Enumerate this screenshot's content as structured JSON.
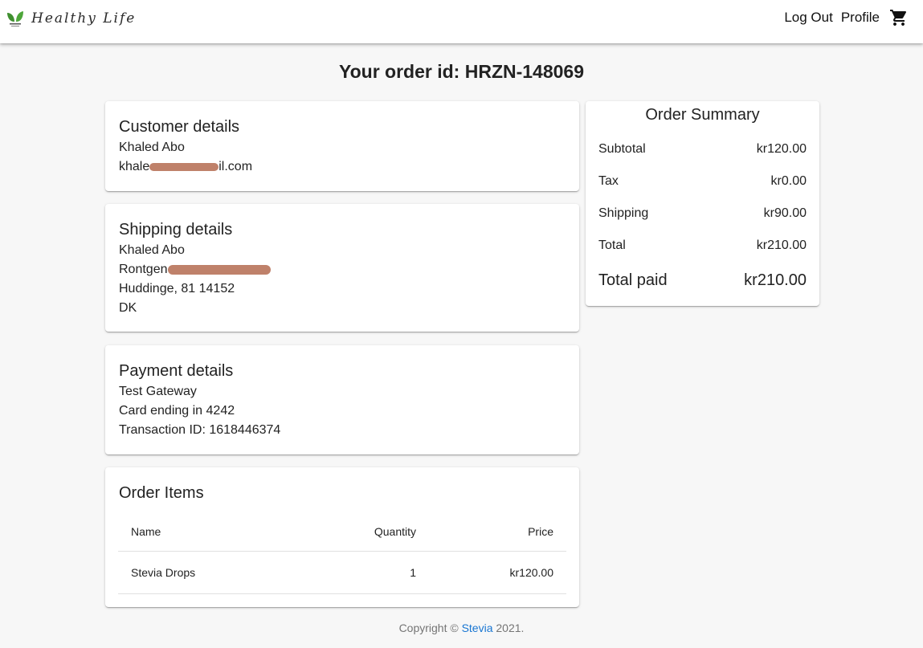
{
  "brand": {
    "title": "Healthy Life",
    "logo_icon": "leaf-logo-icon",
    "logo_color": "#3f8f2f"
  },
  "nav": {
    "logout": "Log Out",
    "profile": "Profile",
    "cart_icon": "shopping-cart-icon"
  },
  "page": {
    "title": "Your order id: HRZN-148069"
  },
  "customer": {
    "heading": "Customer details",
    "name": "Khaled Abo",
    "email_prefix": "khale",
    "email_suffix": "il.com",
    "email_redacted": true
  },
  "shipping": {
    "heading": "Shipping details",
    "name": "Khaled Abo",
    "street_prefix": "Rontgen",
    "street_redacted": true,
    "city_line": "Huddinge, 81 14152",
    "country": "DK"
  },
  "payment": {
    "heading": "Payment details",
    "gateway": "Test Gateway",
    "card": "Card ending in 4242",
    "transaction": "Transaction ID: 1618446374"
  },
  "items": {
    "heading": "Order Items",
    "columns": [
      "Name",
      "Quantity",
      "Price"
    ],
    "rows": [
      {
        "name": "Stevia Drops",
        "quantity": "1",
        "price": "kr120.00"
      }
    ]
  },
  "summary": {
    "heading": "Order Summary",
    "rows": [
      {
        "label": "Subtotal",
        "value": "kr120.00"
      },
      {
        "label": "Tax",
        "value": "kr0.00"
      },
      {
        "label": "Shipping",
        "value": "kr90.00"
      },
      {
        "label": "Total",
        "value": "kr210.00"
      }
    ],
    "paid_label": "Total paid",
    "paid_value": "kr210.00"
  },
  "footer": {
    "prefix": "Copyright © ",
    "link": "Stevia",
    "suffix": " 2021.",
    "link_color": "#1976d2"
  },
  "colors": {
    "background": "#f7f7f7",
    "redaction": "#b8735a"
  }
}
